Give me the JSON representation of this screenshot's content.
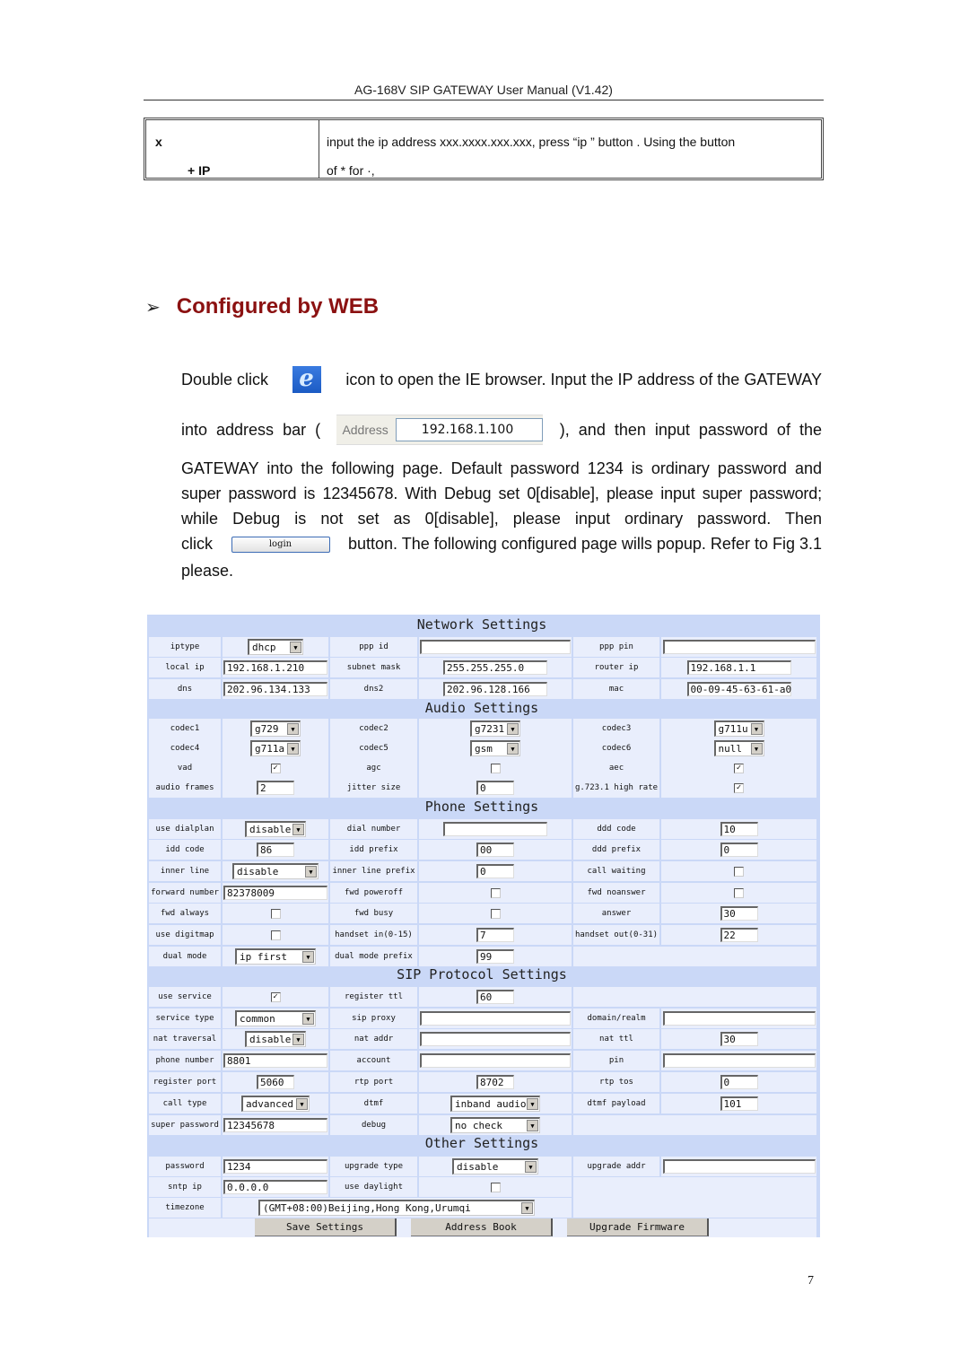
{
  "doc": {
    "running_header": "AG-168V SIP GATEWAY User Manual (V1.42)",
    "page_number": "7"
  },
  "def_table": {
    "key_line1": "x",
    "key_line2": "+ IP",
    "desc_line1": "input the   ip address xxx.xxxx.xxx.xxx, press “ip ” button . Using the button",
    "desc_line2": "of * for ·,"
  },
  "section": {
    "arrow": "➢",
    "title": "Configured by WEB"
  },
  "body": {
    "p1_before_icon": "Double click",
    "p1_after_icon": "icon to open the IE browser. Input the IP address of the GATEWAY",
    "p2_before": "into  address  bar  (",
    "address_label": "Address",
    "address_value": "192.168.1.100",
    "p2_after": "),  and  then  input  password  of  the",
    "p3": "GATEWAY into the following page. Default password 1234 is ordinary password and",
    "p4": "super password is 12345678. With Debug set 0[disable], please input super password;",
    "p5": "while  Debug  is  not  set  as  0[disable],  please  input  ordinary  password.  Then",
    "p6_before": "click",
    "login_label": "login",
    "p6_after": "button. The following configured page wills popup. Refer to Fig 3.1",
    "p7": "please."
  },
  "panel": {
    "network": {
      "title": "Network Settings",
      "iptype_label": "iptype",
      "iptype": "dhcp",
      "ppp_id_label": "ppp id",
      "ppp_id": "",
      "ppp_pin_label": "ppp pin",
      "ppp_pin": "",
      "local_ip_label": "local ip",
      "local_ip": "192.168.1.210",
      "subnet_mask_label": "subnet mask",
      "subnet_mask": "255.255.255.0",
      "router_ip_label": "router ip",
      "router_ip": "192.168.1.1",
      "dns_label": "dns",
      "dns": "202.96.134.133",
      "dns2_label": "dns2",
      "dns2": "202.96.128.166",
      "mac_label": "mac",
      "mac": "00-09-45-63-61-a0"
    },
    "audio": {
      "title": "Audio Settings",
      "codec1_label": "codec1",
      "codec1": "g729",
      "codec2_label": "codec2",
      "codec2": "g7231",
      "codec3_label": "codec3",
      "codec3": "g711u",
      "codec4_label": "codec4",
      "codec4": "g711a",
      "codec5_label": "codec5",
      "codec5": "gsm",
      "codec6_label": "codec6",
      "codec6": "null",
      "vad_label": "vad",
      "vad": true,
      "agc_label": "agc",
      "agc": false,
      "aec_label": "aec",
      "aec": true,
      "audio_frames_label": "audio frames",
      "audio_frames": "2",
      "jitter_size_label": "jitter size",
      "jitter_size": "0",
      "g7231_high_rate_label": "g.723.1 high rate",
      "g7231_high_rate": true
    },
    "phone": {
      "title": "Phone Settings",
      "use_dialplan_label": "use dialplan",
      "use_dialplan": "disable",
      "dial_number_label": "dial number",
      "dial_number": "",
      "ddd_code_label": "ddd code",
      "ddd_code": "10",
      "idd_code_label": "idd code",
      "idd_code": "86",
      "idd_prefix_label": "idd prefix",
      "idd_prefix": "00",
      "ddd_prefix_label": "ddd prefix",
      "ddd_prefix": "0",
      "inner_line_label": "inner line",
      "inner_line": "disable",
      "inner_line_prefix_label": "inner line prefix",
      "inner_line_prefix": "0",
      "call_waiting_label": "call waiting",
      "call_waiting": false,
      "forward_number_label": "forward number",
      "forward_number": "82378009",
      "fwd_poweroff_label": "fwd poweroff",
      "fwd_poweroff": false,
      "fwd_noanswer_label": "fwd noanswer",
      "fwd_noanswer": false,
      "fwd_always_label": "fwd always",
      "fwd_always": false,
      "fwd_busy_label": "fwd busy",
      "fwd_busy": false,
      "answer_label": "answer",
      "answer": "30",
      "use_digitmap_label": "use digitmap",
      "use_digitmap": false,
      "handset_in_label": "handset in(0-15)",
      "handset_in": "7",
      "handset_out_label": "handset out(0-31)",
      "handset_out": "22",
      "dual_mode_label": "dual mode",
      "dual_mode": "ip first",
      "dual_mode_prefix_label": "dual mode prefix",
      "dual_mode_prefix": "99"
    },
    "sip": {
      "title": "SIP Protocol Settings",
      "use_service_label": "use service",
      "use_service": true,
      "register_ttl_label": "register ttl",
      "register_ttl": "60",
      "service_type_label": "service type",
      "service_type": "common",
      "sip_proxy_label": "sip proxy",
      "sip_proxy": "",
      "domain_realm_label": "domain/realm",
      "domain_realm": "",
      "nat_traversal_label": "nat traversal",
      "nat_traversal": "disable",
      "nat_addr_label": "nat addr",
      "nat_addr": "",
      "nat_ttl_label": "nat ttl",
      "nat_ttl": "30",
      "phone_number_label": "phone number",
      "phone_number": "8801",
      "account_label": "account",
      "account": "",
      "pin_label": "pin",
      "pin": "",
      "register_port_label": "register port",
      "register_port": "5060",
      "rtp_port_label": "rtp port",
      "rtp_port": "8702",
      "rtp_tos_label": "rtp tos",
      "rtp_tos": "0",
      "call_type_label": "call type",
      "call_type": "advanced",
      "dtmf_label": "dtmf",
      "dtmf": "inband audio",
      "dtmf_payload_label": "dtmf payload",
      "dtmf_payload": "101",
      "super_password_label": "super password",
      "super_password": "12345678",
      "debug_label": "debug",
      "debug": "no check"
    },
    "other": {
      "title": "Other Settings",
      "password_label": "password",
      "password": "1234",
      "upgrade_type_label": "upgrade type",
      "upgrade_type": "disable",
      "upgrade_addr_label": "upgrade addr",
      "upgrade_addr": "",
      "sntp_ip_label": "sntp ip",
      "sntp_ip": "0.0.0.0",
      "use_daylight_label": "use daylight",
      "use_daylight": false,
      "timezone_label": "timezone",
      "timezone": "(GMT+08:00)Beijing,Hong Kong,Urumqi"
    },
    "buttons": {
      "save": "Save Settings",
      "address_book": "Address Book",
      "upgrade_firmware": "Upgrade Firmware"
    },
    "dropdown_arrow": "▼",
    "check_mark": "✓"
  }
}
